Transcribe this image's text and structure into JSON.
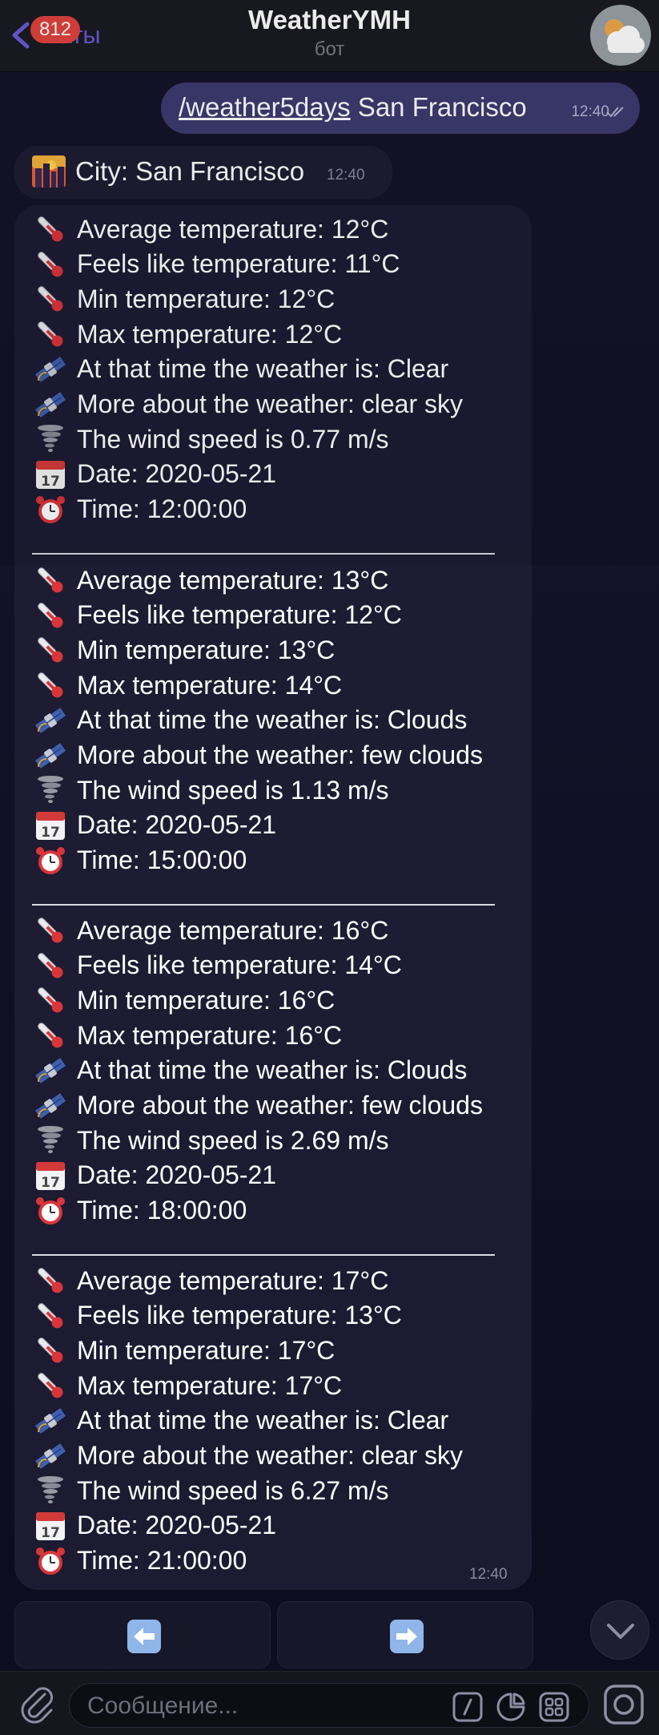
{
  "header": {
    "back_label": "Чаты",
    "unread_badge": "812",
    "title": "WeatherYMH",
    "subtitle": "бот",
    "avatar_icon": "sun-cloud-icon"
  },
  "messages": {
    "outgoing": {
      "command": "/weather5days",
      "text": " San Francisco",
      "time": "12:40",
      "status_icon": "double-check-icon"
    },
    "city": {
      "icon": "cityscape-icon",
      "text": "City: San Francisco",
      "time": "12:40"
    },
    "forecast": {
      "time": "12:40",
      "separator": "________________________________",
      "entries": [
        {
          "avg": "Average temperature: 12°C",
          "feels": "Feels like temperature: 11°C",
          "min": "Min temperature: 12°C",
          "max": "Max temperature: 12°C",
          "weather": "At that time the weather is: Clear",
          "details": "More about the weather: clear sky",
          "wind": "The wind speed is 0.77 m/s",
          "date": "Date: 2020-05-21",
          "time": "Time: 12:00:00"
        },
        {
          "avg": "Average temperature: 13°C",
          "feels": "Feels like temperature: 12°C",
          "min": "Min temperature: 13°C",
          "max": "Max temperature: 14°C",
          "weather": "At that time the weather is: Clouds",
          "details": "More about the weather: few clouds",
          "wind": "The wind speed is 1.13 m/s",
          "date": "Date: 2020-05-21",
          "time": "Time: 15:00:00"
        },
        {
          "avg": "Average temperature: 16°C",
          "feels": "Feels like temperature: 14°C",
          "min": "Min temperature: 16°C",
          "max": "Max temperature: 16°C",
          "weather": "At that time the weather is: Clouds",
          "details": "More about the weather: few clouds",
          "wind": "The wind speed is 2.69 m/s",
          "date": "Date: 2020-05-21",
          "time": "Time: 18:00:00"
        },
        {
          "avg": "Average temperature: 17°C",
          "feels": "Feels like temperature: 13°C",
          "min": "Min temperature: 17°C",
          "max": "Max temperature: 17°C",
          "weather": "At that time the weather is: Clear",
          "details": "More about the weather: clear sky",
          "wind": "The wind speed is 6.27 m/s",
          "date": "Date: 2020-05-21",
          "time": "Time: 21:00:00"
        }
      ]
    }
  },
  "keyboard": {
    "left_icon": "left-arrow-icon",
    "right_icon": "right-arrow-icon"
  },
  "input_bar": {
    "placeholder": "Сообщение..."
  },
  "colors": {
    "accent": "#6a5bd6",
    "outgoing_bubble": "#3d3a70",
    "incoming_bubble": "#1e1d33",
    "badge": "#e0433c"
  }
}
